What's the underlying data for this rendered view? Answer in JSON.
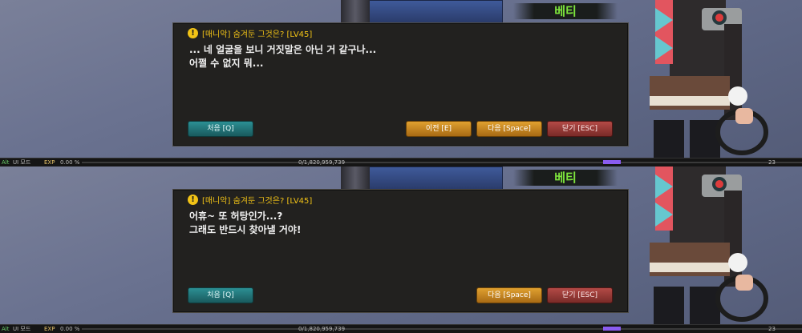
{
  "screens": [
    {
      "npc_name": "베티",
      "quest_title": "[매니악] 숨겨둔 그것은? [LV45]",
      "lines": [
        "... 네 얼굴을 보니 거짓말은 아닌 거 같구나...",
        "어쩔 수 없지 뭐..."
      ],
      "buttons": {
        "first": "처음 [Q]",
        "prev": "이전 [E]",
        "next": "다음 [Space]",
        "close": "닫기 [ESC]"
      }
    },
    {
      "npc_name": "베티",
      "quest_title": "[매니악] 숨겨둔 그것은? [LV45]",
      "lines": [
        "어휴~ 또 허탕인가...?",
        "그래도 반드시 찾아낼 거야!"
      ],
      "buttons": {
        "first": "처음 [Q]",
        "next": "다음 [Space]",
        "close": "닫기 [ESC]"
      }
    }
  ],
  "statusbar": {
    "alt_key": "Alt",
    "ui_mode": "UI 모드",
    "exp_label": "EXP",
    "exp_percent": "0.00 %",
    "exp_value": "0/1,820,959,739",
    "level_value": "23"
  },
  "colors": {
    "quest_accent": "#f2c316",
    "npc_name": "#7ee63c",
    "exp_purple": "#8a5cf0"
  }
}
